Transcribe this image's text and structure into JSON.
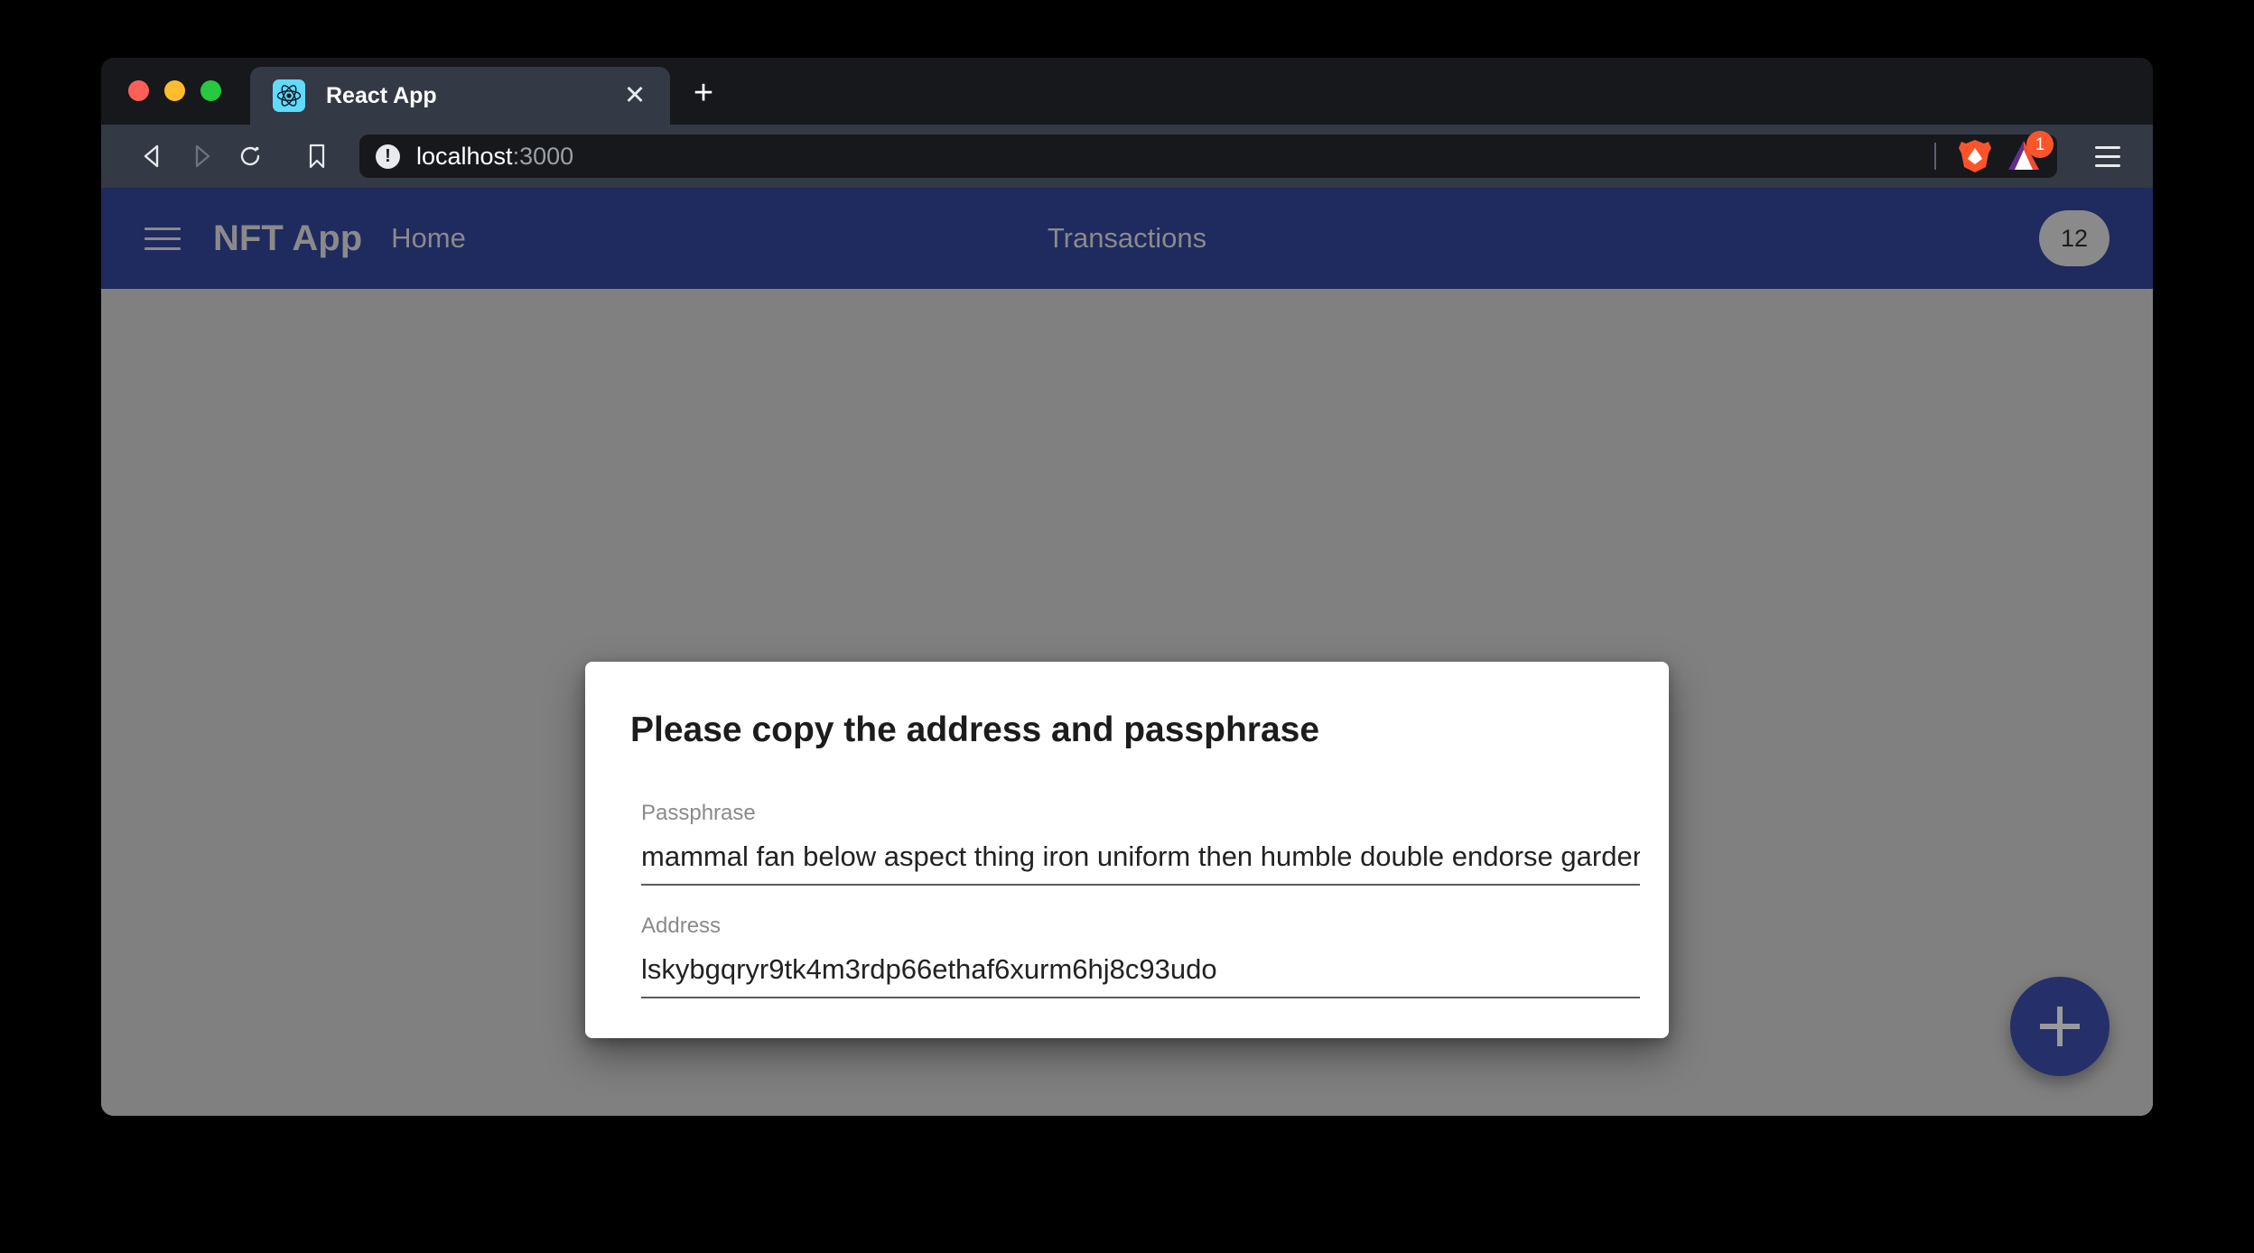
{
  "browser": {
    "traffic_lights": [
      "close",
      "minimize",
      "maximize"
    ],
    "tab": {
      "title": "React App",
      "favicon": "react-logo-icon",
      "close_label": "✕"
    },
    "new_tab_label": "+",
    "toolbar": {
      "back_icon": "back-arrow-icon",
      "forward_icon": "forward-arrow-icon",
      "reload_icon": "reload-icon",
      "bookmark_icon": "bookmark-icon",
      "url_info_icon": "!",
      "url_host": "localhost",
      "url_port": ":3000",
      "url_full": "localhost:3000",
      "brave_shield_icon": "brave-lion-icon",
      "bat_rewards_icon": "bat-triangle-icon",
      "bat_badge_count": "1",
      "menu_icon": "hamburger-menu-icon"
    }
  },
  "app": {
    "navbar": {
      "menu_icon": "hamburger-menu-icon",
      "title": "NFT App",
      "home_label": "Home",
      "center_label": "Transactions",
      "badge_count": "12",
      "background_color": "#1f2a5e",
      "text_color": "#8a8a8a"
    },
    "overlay_color": "#808080",
    "dialog": {
      "title": "Please copy the address and passphrase",
      "fields": [
        {
          "label": "Passphrase",
          "value": "mammal fan below aspect thing iron uniform then humble double endorse garden"
        },
        {
          "label": "Address",
          "value": "lskybgqryr9tk4m3rdp66ethaf6xurm6hj8c93udo"
        }
      ]
    },
    "fab": {
      "icon": "plus-icon",
      "color": "#25306a"
    }
  }
}
